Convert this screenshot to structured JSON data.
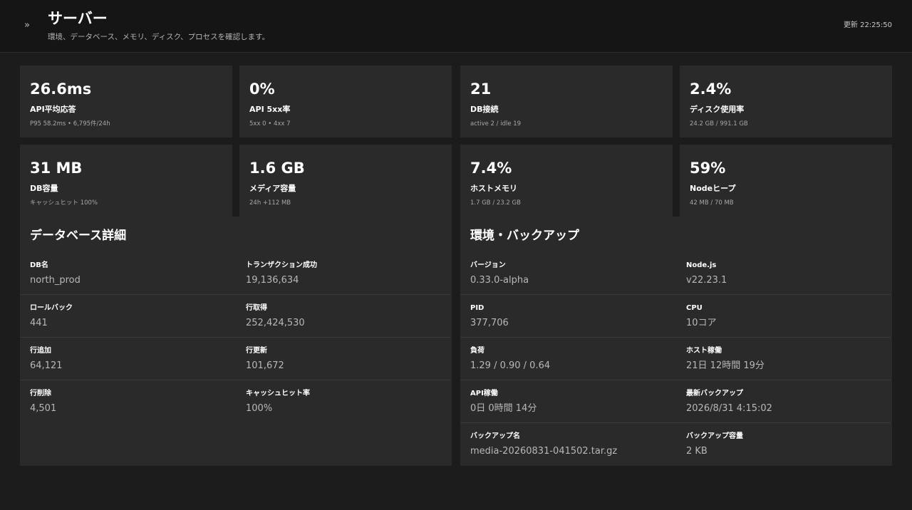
{
  "header": {
    "collapse_glyph": "»",
    "title": "サーバー",
    "subtitle": "環境、データベース、メモリ、ディスク、プロセスを確認します。",
    "updated": "更新 22:25:50"
  },
  "metrics": [
    {
      "value": "26.6ms",
      "label": "API平均応答",
      "sub": "P95 58.2ms • 6,795件/24h"
    },
    {
      "value": "0%",
      "label": "API 5xx率",
      "sub": "5xx 0 • 4xx 7"
    },
    {
      "value": "21",
      "label": "DB接続",
      "sub": "active 2 / idle 19"
    },
    {
      "value": "2.4%",
      "label": "ディスク使用率",
      "sub": "24.2 GB / 991.1 GB"
    },
    {
      "value": "31 MB",
      "label": "DB容量",
      "sub": "キャッシュヒット 100%"
    },
    {
      "value": "1.6 GB",
      "label": "メディア容量",
      "sub": "24h +112 MB"
    },
    {
      "value": "7.4%",
      "label": "ホストメモリ",
      "sub": "1.7 GB / 23.2 GB"
    },
    {
      "value": "59%",
      "label": "Nodeヒープ",
      "sub": "42 MB / 70 MB"
    }
  ],
  "database": {
    "title": "データベース詳細",
    "rows": [
      [
        {
          "key": "DB名",
          "value": "north_prod"
        },
        {
          "key": "トランザクション成功",
          "value": "19,136,634"
        }
      ],
      [
        {
          "key": "ロールバック",
          "value": "441"
        },
        {
          "key": "行取得",
          "value": "252,424,530"
        }
      ],
      [
        {
          "key": "行追加",
          "value": "64,121"
        },
        {
          "key": "行更新",
          "value": "101,672"
        }
      ],
      [
        {
          "key": "行削除",
          "value": "4,501"
        },
        {
          "key": "キャッシュヒット率",
          "value": "100%"
        }
      ]
    ]
  },
  "environment": {
    "title": "環境・バックアップ",
    "rows": [
      [
        {
          "key": "バージョン",
          "value": "0.33.0-alpha"
        },
        {
          "key": "Node.js",
          "value": "v22.23.1"
        }
      ],
      [
        {
          "key": "PID",
          "value": "377,706"
        },
        {
          "key": "CPU",
          "value": "10コア"
        }
      ],
      [
        {
          "key": "負荷",
          "value": "1.29 / 0.90 / 0.64"
        },
        {
          "key": "ホスト稼働",
          "value": "21日 12時間 19分"
        }
      ],
      [
        {
          "key": "API稼働",
          "value": "0日 0時間 14分"
        },
        {
          "key": "最新バックアップ",
          "value": "2026/8/31 4:15:02"
        }
      ],
      [
        {
          "key": "バックアップ名",
          "value": "media-20260831-041502.tar.gz"
        },
        {
          "key": "バックアップ容量",
          "value": "2 KB"
        }
      ]
    ]
  }
}
